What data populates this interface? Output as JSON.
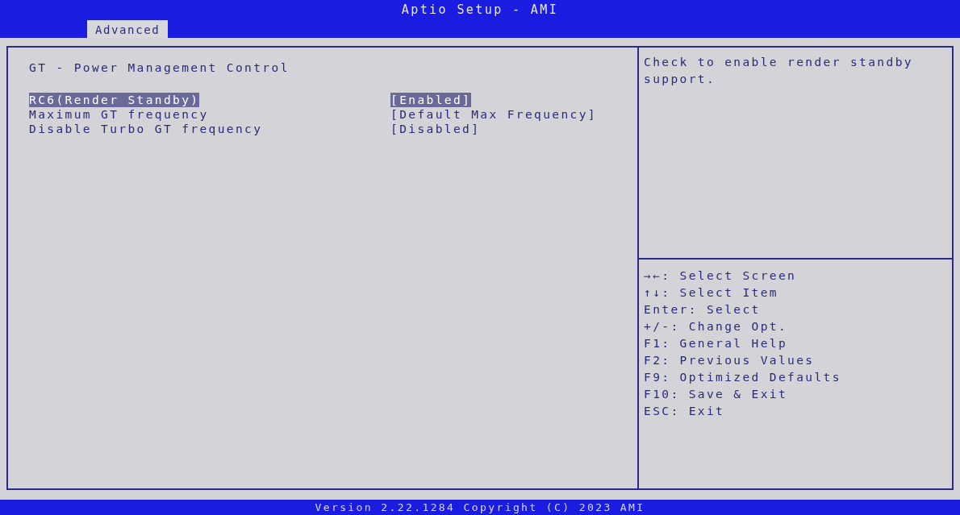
{
  "window": {
    "title": "Aptio Setup - AMI"
  },
  "tabs": [
    {
      "label": "Advanced",
      "selected": true
    }
  ],
  "page": {
    "heading": "GT - Power Management Control",
    "items": [
      {
        "label": "RC6(Render Standby)",
        "value": "[Enabled]",
        "selected": true
      },
      {
        "label": "Maximum GT frequency",
        "value": "[Default Max Frequency]",
        "selected": false
      },
      {
        "label": "Disable Turbo GT frequency",
        "value": "[Disabled]",
        "selected": false
      }
    ]
  },
  "help": {
    "text": [
      "Check to enable render standby",
      "support."
    ],
    "keys": [
      "→←: Select Screen",
      "↑↓: Select Item",
      "Enter: Select",
      "+/-: Change Opt.",
      "F1: General Help",
      "F2: Previous Values",
      "F9: Optimized Defaults",
      "F10: Save & Exit",
      "ESC: Exit"
    ]
  },
  "status_bar": "Version 2.22.1284 Copyright (C) 2023 AMI"
}
